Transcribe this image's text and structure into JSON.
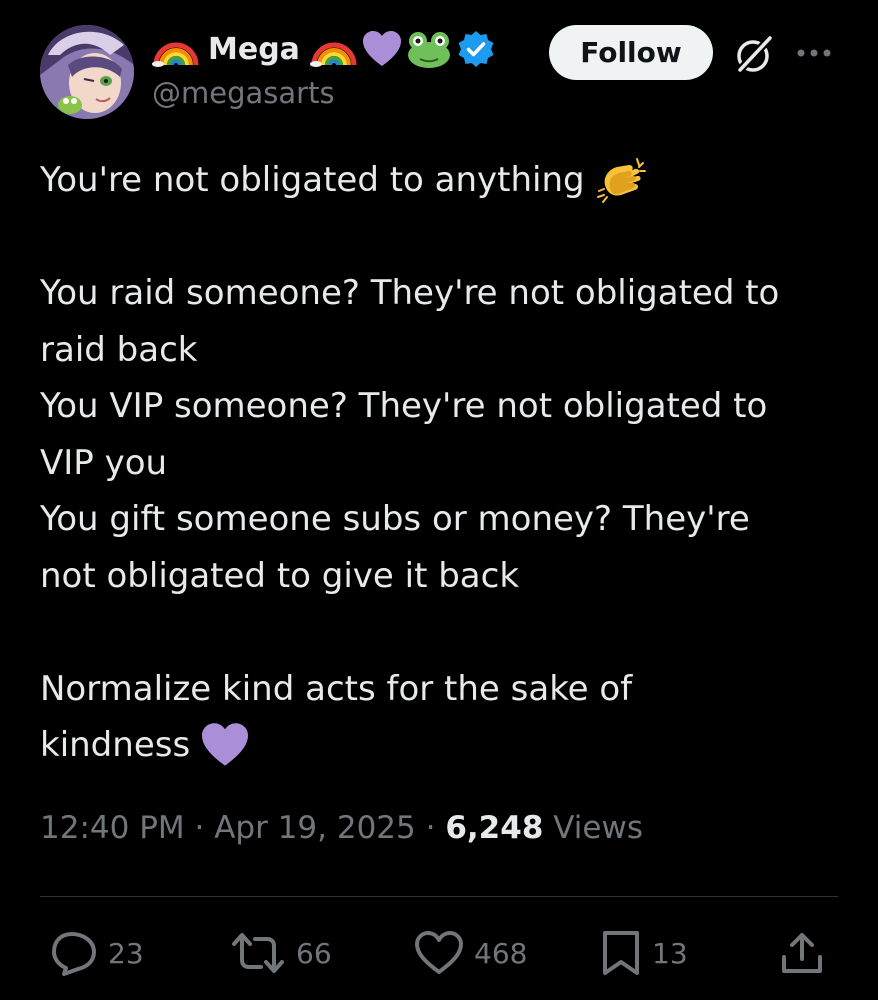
{
  "author": {
    "display_name": "Mega",
    "handle": "@megasarts",
    "verified": true,
    "name_emoji_before": "rainbow-emoji",
    "name_emoji_after": [
      "rainbow-emoji",
      "purple-heart-emoji",
      "frog-emoji",
      "verified-badge-icon"
    ]
  },
  "header": {
    "follow_label": "Follow",
    "follow_bg": "#eff3f4",
    "grok_icon": "grok-icon",
    "more_icon": "more-icon"
  },
  "tweet": {
    "lines": [
      "You're not obligated to anything",
      "",
      "You raid someone? They're not obligated to",
      "raid back",
      "You VIP someone? They're not obligated to",
      "VIP you",
      "You gift someone subs or money? They're",
      "not obligated to give it back",
      "",
      "Normalize kind acts for the sake of",
      "kindness"
    ],
    "inline_emojis": {
      "line_1": "clapping-hands-emoji",
      "line_11": "purple-heart-emoji"
    }
  },
  "meta": {
    "time": "12:40 PM",
    "separator": "·",
    "date": "Apr 19, 2025",
    "views_count": "6,248",
    "views_label": "Views"
  },
  "actions": {
    "replies": "23",
    "reposts": "66",
    "likes": "468",
    "bookmarks": "13",
    "share_icon": "share-icon"
  },
  "colors": {
    "background": "#000000",
    "text": "#e7e9ea",
    "muted": "#71767b",
    "divider": "#2f3336",
    "verified_blue": "#1d9bf0",
    "purple_heart": "#ab8ed8"
  }
}
